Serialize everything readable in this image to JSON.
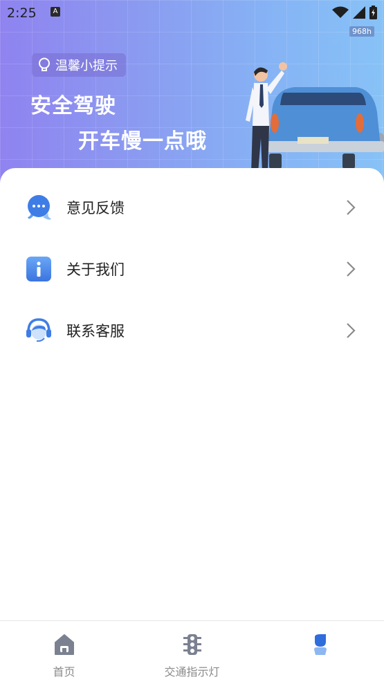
{
  "status_bar": {
    "time": "2:25",
    "app_badge": "A",
    "refresh_rate": "968h"
  },
  "banner": {
    "tip_label": "温馨小提示",
    "slogan_line1": "安全驾驶",
    "slogan_line2": "开车慢一点哦"
  },
  "menu": {
    "items": [
      {
        "label": "意见反馈",
        "icon": "feedback-chat-icon"
      },
      {
        "label": "关于我们",
        "icon": "info-icon"
      },
      {
        "label": "联系客服",
        "icon": "customer-service-icon"
      }
    ]
  },
  "tabbar": {
    "tabs": [
      {
        "label": "首页",
        "icon": "home-icon"
      },
      {
        "label": "交通指示灯",
        "icon": "traffic-light-icon"
      },
      {
        "label": "",
        "icon": "profile-icon",
        "active": true
      }
    ]
  },
  "colors": {
    "accent": "#3f7de6",
    "banner_start": "#8f83f0",
    "banner_end": "#87c2f6",
    "tab_inactive": "#8a8a8a"
  }
}
